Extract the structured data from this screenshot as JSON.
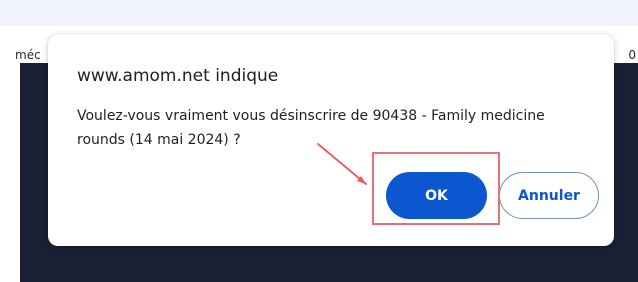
{
  "background": {
    "left_text": "méc",
    "right_text": "0"
  },
  "dialog": {
    "title": "www.amom.net indique",
    "message": "Voulez-vous vraiment vous désinscrire de 90438 - Family medicine rounds (14 mai 2024) ?",
    "ok_label": "OK",
    "cancel_label": "Annuler"
  },
  "colors": {
    "primary_button": "#0b57d0",
    "highlight": "#ea6f74",
    "dark_background": "#1a2135",
    "top_strip": "#f1f3fb"
  }
}
